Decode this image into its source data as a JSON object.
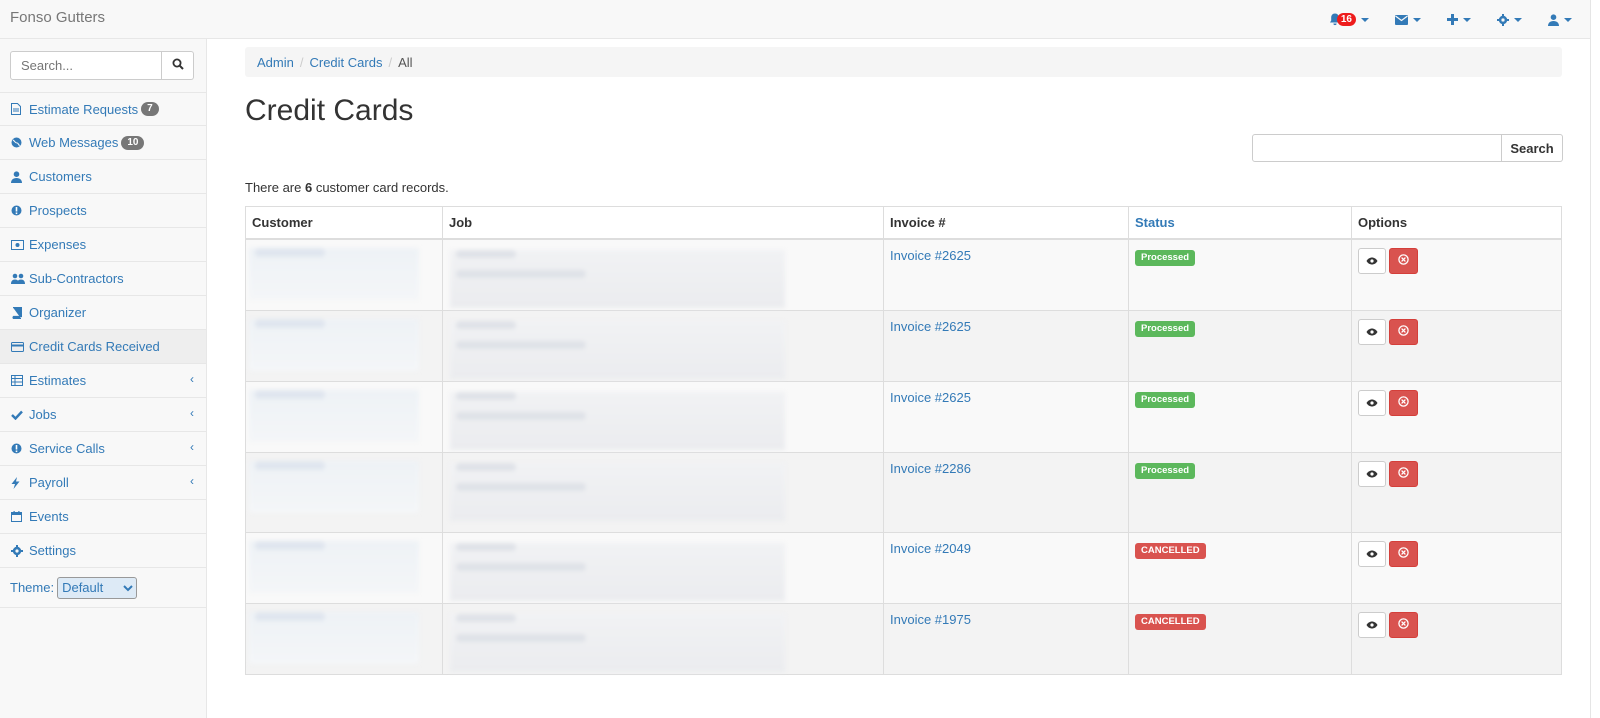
{
  "navbar": {
    "brand": "Fonso Gutters",
    "notifications_count": "16",
    "icons": [
      "bell-icon",
      "envelope-icon",
      "plus-icon",
      "gear-icon",
      "user-icon"
    ]
  },
  "sidebar": {
    "search_placeholder": "Search...",
    "items": [
      {
        "label": "Estimate Requests",
        "icon": "file-icon",
        "badge": "7"
      },
      {
        "label": "Web Messages",
        "icon": "globe-icon",
        "badge": "10"
      },
      {
        "label": "Customers",
        "icon": "user-icon"
      },
      {
        "label": "Prospects",
        "icon": "info-circle-icon"
      },
      {
        "label": "Expenses",
        "icon": "money-icon"
      },
      {
        "label": "Sub-Contractors",
        "icon": "users-icon"
      },
      {
        "label": "Organizer",
        "icon": "book-icon"
      },
      {
        "label": "Credit Cards Received",
        "icon": "credit-card-icon",
        "active": true
      },
      {
        "label": "Estimates",
        "icon": "table-icon",
        "expandable": true
      },
      {
        "label": "Jobs",
        "icon": "check-icon",
        "expandable": true
      },
      {
        "label": "Service Calls",
        "icon": "exclamation-circle-icon",
        "expandable": true
      },
      {
        "label": "Payroll",
        "icon": "bolt-icon",
        "expandable": true
      },
      {
        "label": "Events",
        "icon": "calendar-icon"
      },
      {
        "label": "Settings",
        "icon": "cog-icon"
      }
    ],
    "theme_label": "Theme:",
    "theme_value": "Default"
  },
  "breadcrumb": [
    "Admin",
    "Credit Cards",
    "All"
  ],
  "page_title": "Credit Cards",
  "search_button": "Search",
  "record_count": {
    "prefix": "There are ",
    "count": "6",
    "suffix": " customer card records."
  },
  "table": {
    "headers": [
      "Customer",
      "Job",
      "Invoice #",
      "Status",
      "Options"
    ],
    "rows": [
      {
        "invoice": "Invoice #2625",
        "status": "Processed"
      },
      {
        "invoice": "Invoice #2625",
        "status": "Processed"
      },
      {
        "invoice": "Invoice #2625",
        "status": "Processed"
      },
      {
        "invoice": "Invoice #2286",
        "status": "Processed"
      },
      {
        "invoice": "Invoice #2049",
        "status": "CANCELLED"
      },
      {
        "invoice": "Invoice #1975",
        "status": "CANCELLED"
      }
    ]
  },
  "colors": {
    "link": "#337ab7",
    "success": "#5cb85c",
    "danger": "#d9534f",
    "alert": "#ee1c1c"
  }
}
